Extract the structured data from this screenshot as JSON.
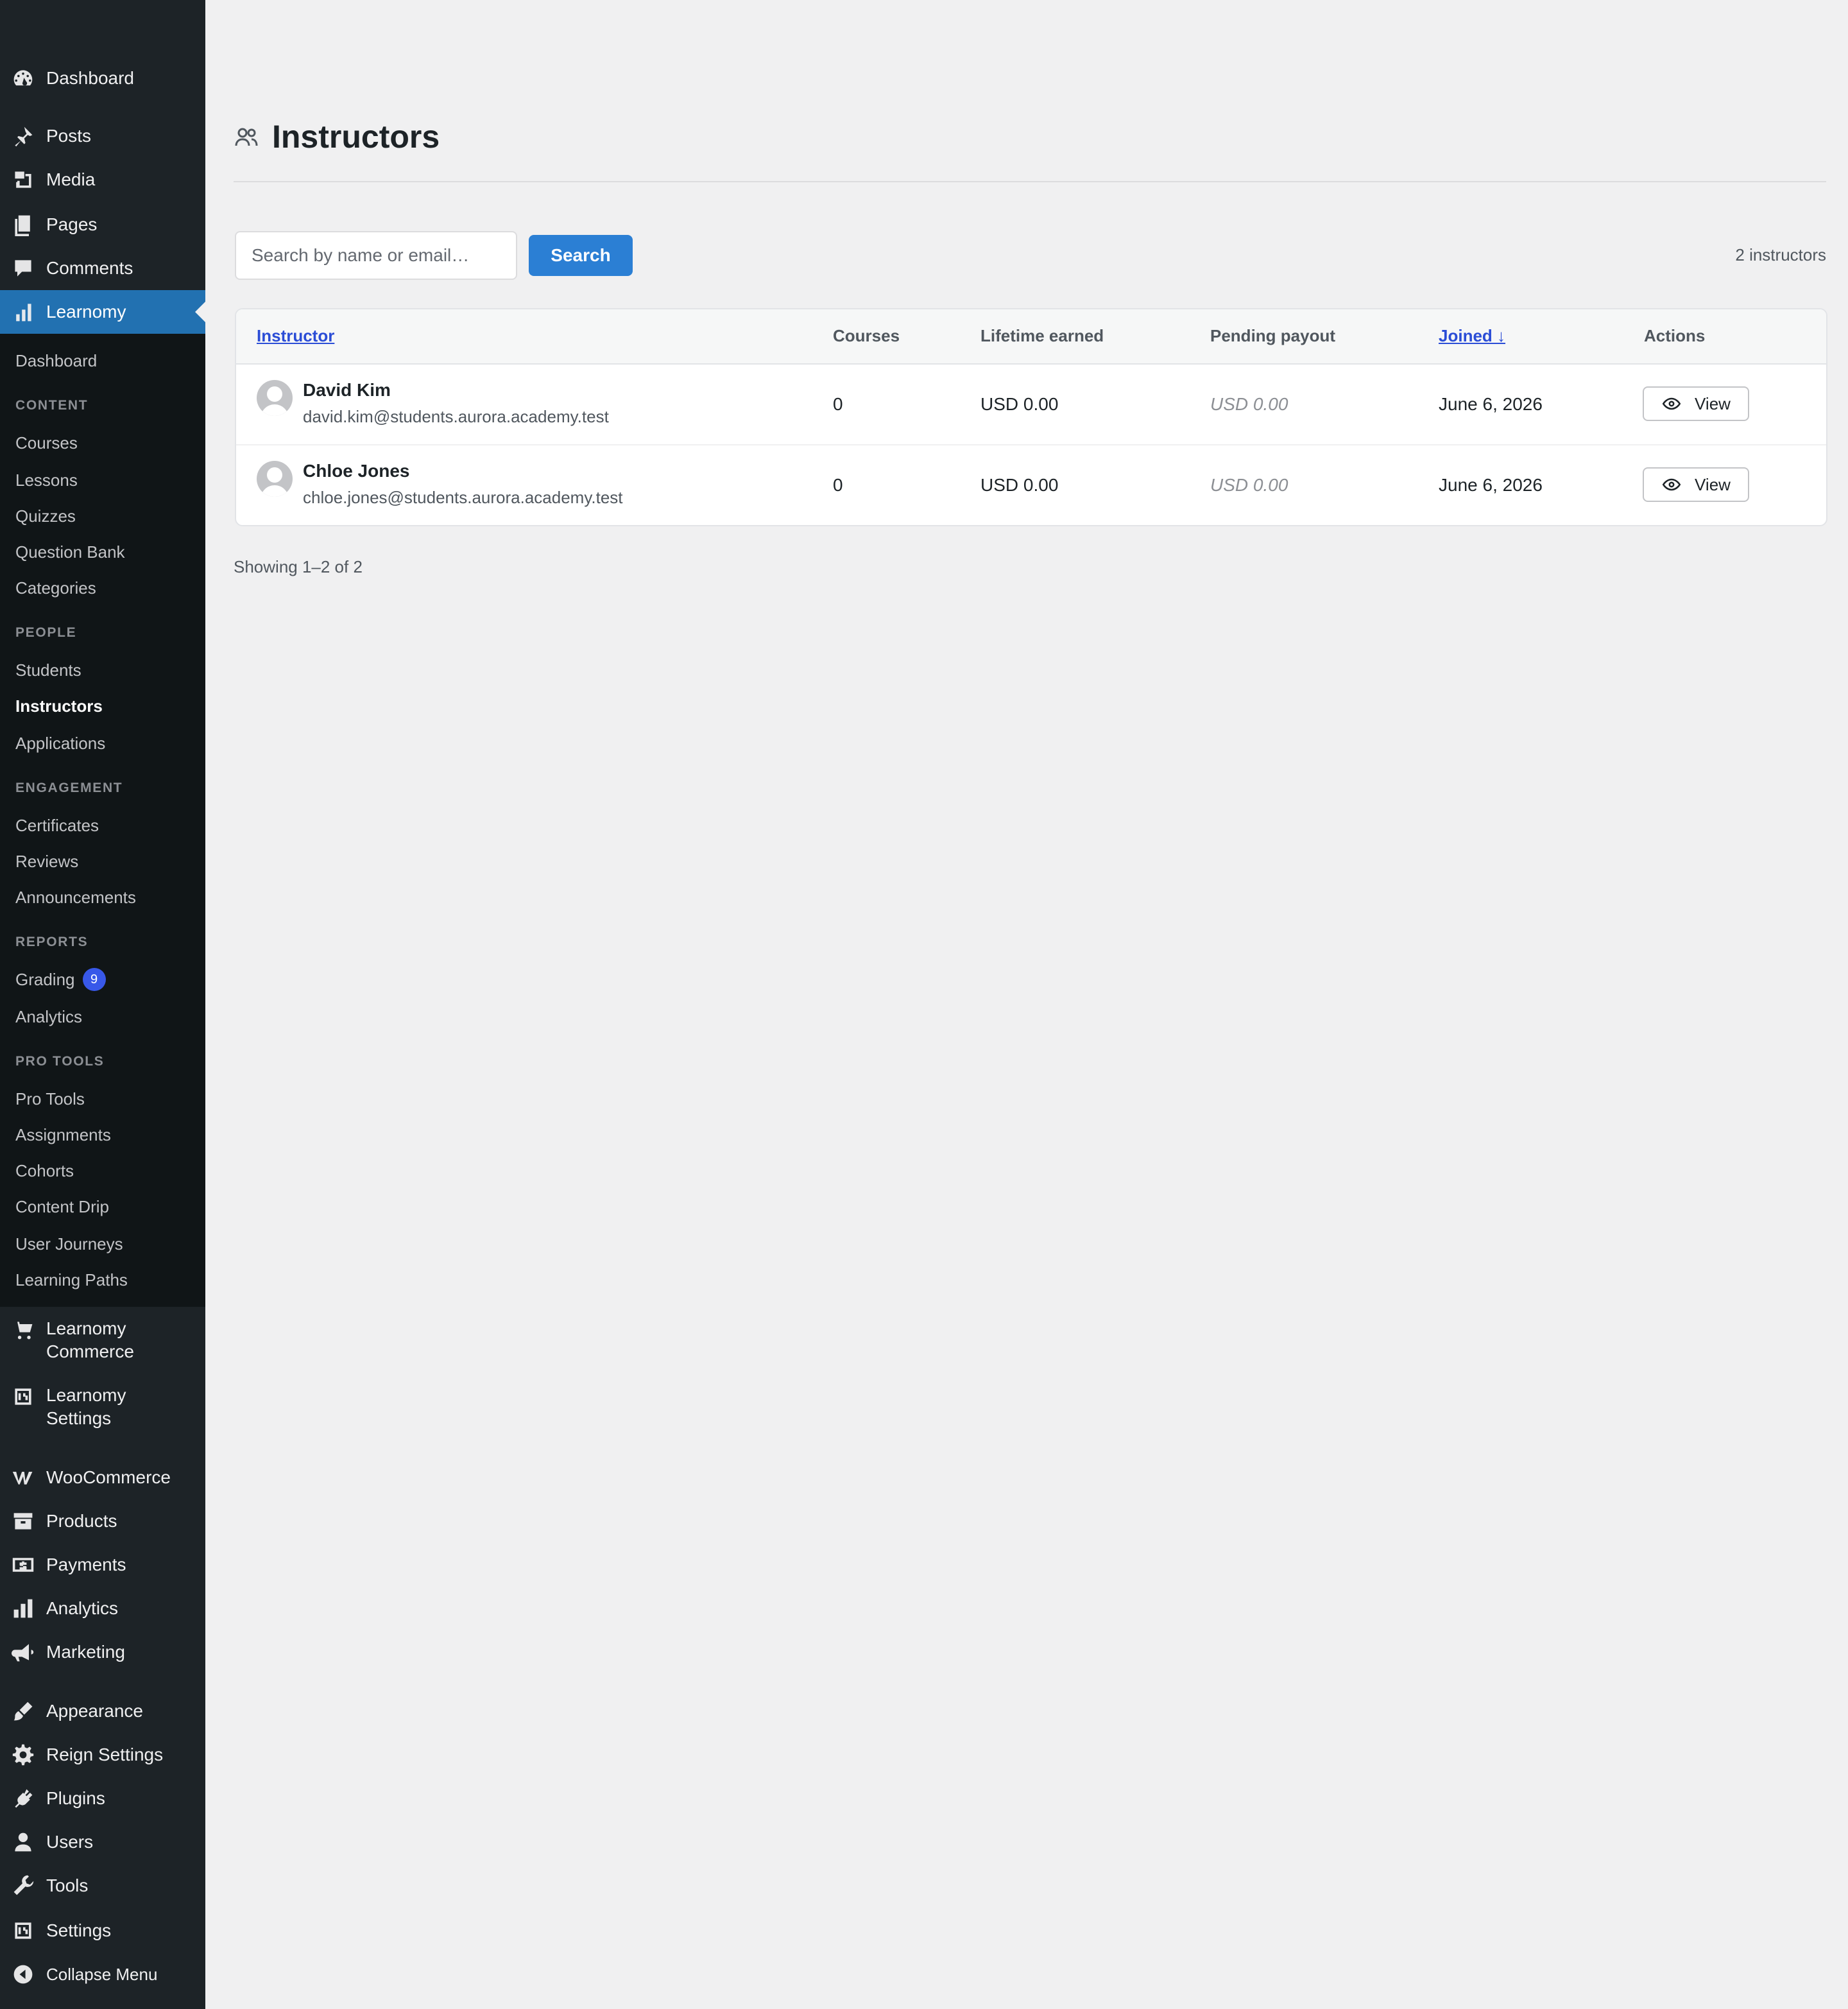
{
  "sidebar": {
    "top_items": [
      {
        "label": "Dashboard",
        "icon": "dashboard-icon"
      },
      {
        "label": "Posts",
        "icon": "pin-icon"
      },
      {
        "label": "Media",
        "icon": "media-icon"
      },
      {
        "label": "Pages",
        "icon": "pages-icon"
      },
      {
        "label": "Comments",
        "icon": "comments-icon"
      },
      {
        "label": "Learnomy",
        "icon": "chart-icon",
        "active": true
      }
    ],
    "submenu": {
      "dashboard": "Dashboard",
      "sections": {
        "content": "CONTENT",
        "people": "PEOPLE",
        "engagement": "ENGAGEMENT",
        "reports": "REPORTS",
        "pro_tools": "PRO TOOLS"
      },
      "content": [
        "Courses",
        "Lessons",
        "Quizzes",
        "Question Bank",
        "Categories"
      ],
      "people": [
        "Students",
        "Instructors",
        "Applications"
      ],
      "engagement": [
        "Certificates",
        "Reviews",
        "Announcements"
      ],
      "reports": [
        "Grading",
        "Analytics"
      ],
      "grading_badge": "9",
      "pro_tools": [
        "Pro Tools",
        "Assignments",
        "Cohorts",
        "Content Drip",
        "User Journeys",
        "Learning Paths"
      ]
    },
    "lower_items": [
      {
        "label": "Learnomy Commerce",
        "icon": "cart-icon"
      },
      {
        "label": "Learnomy Settings",
        "icon": "settings-sliders-icon"
      },
      {
        "label": "WooCommerce",
        "icon": "woocommerce-icon"
      },
      {
        "label": "Products",
        "icon": "archive-icon"
      },
      {
        "label": "Payments",
        "icon": "dollar-icon"
      },
      {
        "label": "Analytics",
        "icon": "bar-chart-icon"
      },
      {
        "label": "Marketing",
        "icon": "megaphone-icon"
      },
      {
        "label": "Appearance",
        "icon": "brush-icon"
      },
      {
        "label": "Reign Settings",
        "icon": "gear-icon"
      },
      {
        "label": "Plugins",
        "icon": "plug-icon"
      },
      {
        "label": "Users",
        "icon": "user-icon"
      },
      {
        "label": "Tools",
        "icon": "wrench-icon"
      },
      {
        "label": "Settings",
        "icon": "settings-sliders-icon"
      },
      {
        "label": "Collapse Menu",
        "icon": "collapse-icon"
      }
    ]
  },
  "page": {
    "title": "Instructors",
    "title_icon": "people-icon",
    "search_placeholder": "Search by name or email…",
    "search_button": "Search",
    "count_text": "2 instructors",
    "showing_text": "Showing 1–2 of 2"
  },
  "table": {
    "headers": {
      "instructor": "Instructor",
      "courses": "Courses",
      "lifetime": "Lifetime earned",
      "pending": "Pending payout",
      "joined": "Joined ↓",
      "actions": "Actions"
    },
    "rows": [
      {
        "name": "David Kim",
        "email": "david.kim@students.aurora.academy.test",
        "courses": "0",
        "lifetime": "USD 0.00",
        "pending": "USD 0.00",
        "joined": "June 6, 2026",
        "action": "View"
      },
      {
        "name": "Chloe Jones",
        "email": "chloe.jones@students.aurora.academy.test",
        "courses": "0",
        "lifetime": "USD 0.00",
        "pending": "USD 0.00",
        "joined": "June 6, 2026",
        "action": "View"
      }
    ]
  },
  "colors": {
    "sidebar_bg": "#1d2327",
    "submenu_bg": "#101517",
    "accent": "#2271b1",
    "button": "#2b7fd4",
    "link": "#2b4dd6",
    "badge": "#3858e9"
  }
}
